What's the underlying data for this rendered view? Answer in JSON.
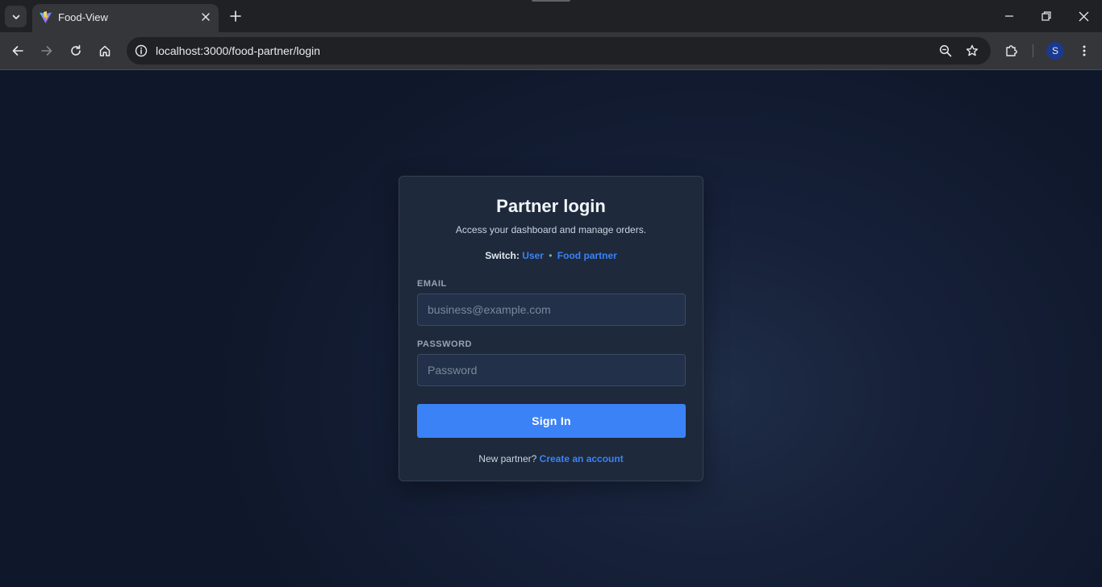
{
  "browser": {
    "tab_title": "Food-View",
    "url_host": "localhost",
    "url_rest": ":3000/food-partner/login",
    "profile_initial": "S"
  },
  "login": {
    "title": "Partner login",
    "subtitle": "Access your dashboard and manage orders.",
    "switch_label": "Switch:",
    "switch_user": "User",
    "switch_separator": "•",
    "switch_partner": "Food partner",
    "email_label": "EMAIL",
    "email_placeholder": "business@example.com",
    "email_value": "",
    "password_label": "PASSWORD",
    "password_placeholder": "Password",
    "password_value": "",
    "submit_label": "Sign In",
    "footer_text": "New partner?",
    "footer_link": "Create an account"
  },
  "colors": {
    "accent": "#3b82f6",
    "card_bg": "#1e293b",
    "page_bg": "#0f172a"
  }
}
